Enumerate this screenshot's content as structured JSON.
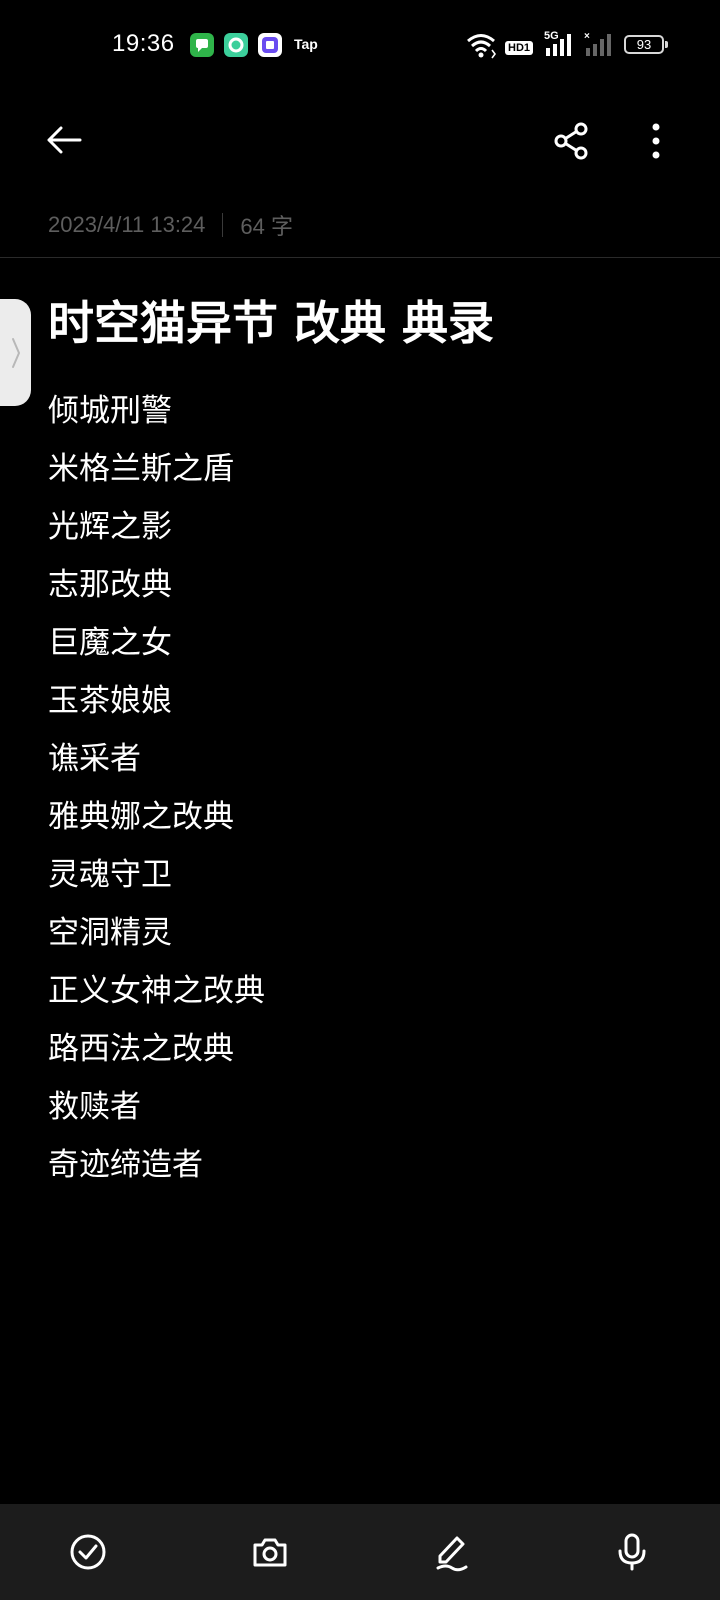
{
  "status_bar": {
    "time": "19:36",
    "notification_icons": [
      "messages-icon",
      "green-app-icon",
      "paste-app-icon"
    ],
    "notification_text": "Tap",
    "network_label": "HD1",
    "signal_label": "5G",
    "battery_level": "93"
  },
  "header": {
    "back_icon": "back-arrow-icon",
    "share_icon": "share-icon",
    "more_icon": "more-vertical-icon"
  },
  "meta": {
    "date": "2023/4/11 13:24",
    "word_count": "64 字"
  },
  "note": {
    "title": "时空猫异节 改典 典录",
    "lines": [
      "倾城刑警",
      "米格兰斯之盾",
      "光辉之影",
      "志那改典",
      "巨魔之女",
      "玉茶娘娘",
      "谯采者",
      "雅典娜之改典",
      "灵魂守卫",
      "空洞精灵",
      "正义女神之改典",
      "路西法之改典",
      "救赎者",
      "奇迹缔造者"
    ]
  },
  "toolbar": {
    "items": [
      "checklist-icon",
      "camera-icon",
      "handwriting-icon",
      "microphone-icon"
    ]
  },
  "colors": {
    "background": "#000000",
    "text": "#ffffff",
    "meta_text": "#5e5e5e",
    "toolbar_bg": "#1c1c1c"
  }
}
